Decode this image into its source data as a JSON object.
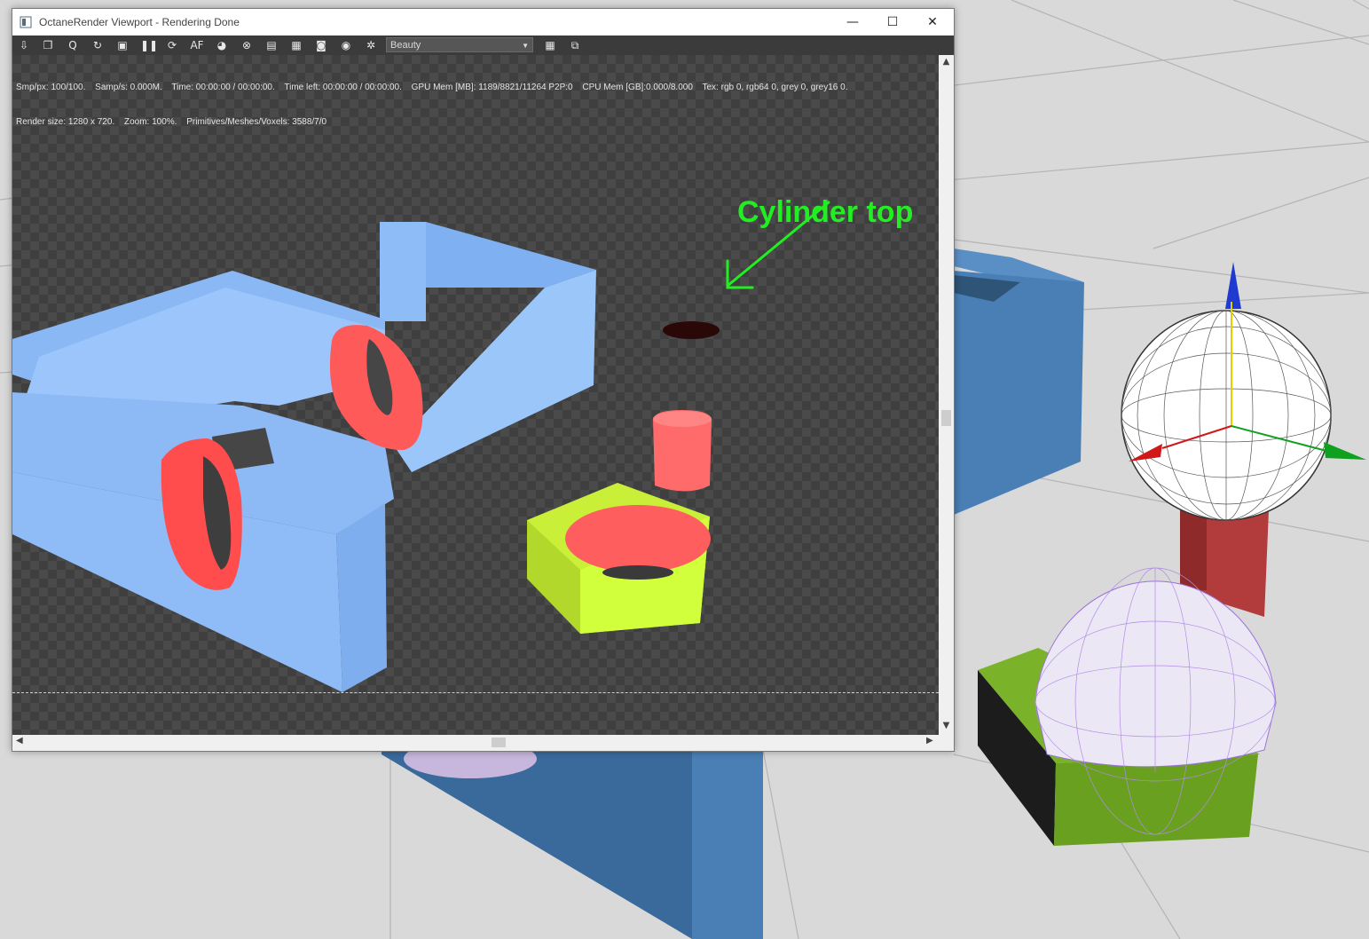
{
  "window": {
    "title": "OctaneRender Viewport - Rendering Done",
    "controls": {
      "minimize": "—",
      "maximize": "☐",
      "close": "✕"
    }
  },
  "toolbar": {
    "icons": [
      "export-icon",
      "copy-icon",
      "zoom-q-icon",
      "restart-icon",
      "lock-icon",
      "pause-icon",
      "refresh-icon",
      "af-icon",
      "color-wheel-icon",
      "target-icon",
      "display-icon",
      "clock-icon",
      "camera-icon",
      "render-camera-icon",
      "settings-gear-icon"
    ],
    "pass_select": "Beauty",
    "right_icons": [
      "grid-icon",
      "region-icon"
    ]
  },
  "stats": {
    "line1": [
      "Smp/px: 100/100.",
      "Samp/s: 0.000M.",
      "Time: 00:00:00 / 00:00:00.",
      "Time left: 00:00:00 / 00:00:00.",
      "GPU Mem [MB]: 1189/8821/11264 P2P:0",
      "CPU Mem [GB]:0.000/8.000",
      "Tex: rgb 0, rgb64 0, grey 0, grey16 0."
    ],
    "line2": [
      "Render size: 1280 x 720.",
      "Zoom: 100%.",
      "Primitives/Meshes/Voxels: 3588/7/0"
    ]
  },
  "annotation": {
    "text": "Cylinder top",
    "color": "#22ee22"
  },
  "colors": {
    "blue_object": "#8ab8f5",
    "red_cut": "#ff5a5a",
    "yellow_green_object": "#c8ff3a",
    "viewport_blue": "#4a7fb5",
    "viewport_green": "#6aa020",
    "viewport_red": "#b03a3a"
  },
  "scrollbars": {
    "up": "▲",
    "down": "▼",
    "left": "◀",
    "right": "▶"
  }
}
